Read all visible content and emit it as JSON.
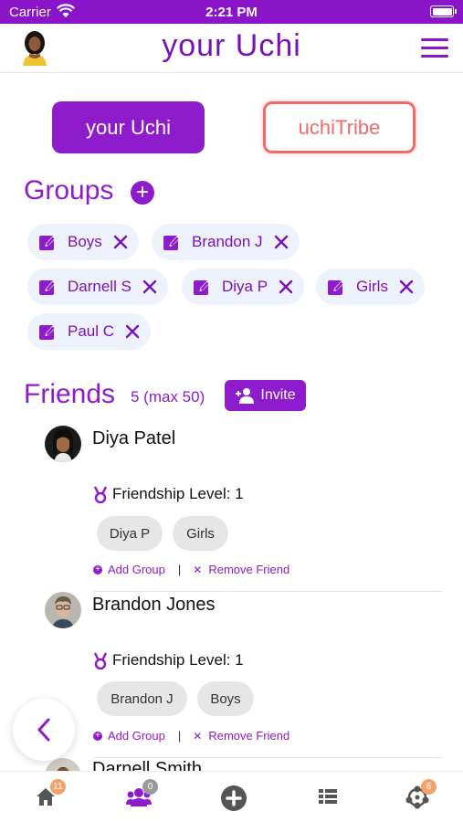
{
  "status_bar": {
    "carrier": "Carrier",
    "time": "2:21 PM"
  },
  "header": {
    "title": "your Uchi"
  },
  "segments": {
    "uchi": "your Uchi",
    "tribe": "uchiTribe"
  },
  "groups": {
    "title": "Groups",
    "chips": [
      "Boys",
      "Brandon J",
      "Darnell S",
      "Diya P",
      "Girls",
      "Paul C"
    ]
  },
  "friends": {
    "title": "Friends",
    "count": "5 (max 50)",
    "invite_label": "Invite",
    "items": [
      {
        "name": "Diya Patel",
        "level": "Friendship Level: 1",
        "groups": [
          "Diya P",
          "Girls"
        ]
      },
      {
        "name": "Brandon Jones",
        "level": "Friendship Level: 1",
        "groups": [
          "Brandon J",
          "Boys"
        ]
      },
      {
        "name": "Darnell Smith"
      }
    ],
    "add_group_label": "Add Group",
    "separator": "|",
    "remove_friend_label": "Remove Friend"
  },
  "tab_bar": {
    "home_badge": "11",
    "friends_badge": "0",
    "tribe_badge": "6"
  },
  "colors": {
    "brand": "#8f1ccc",
    "tribe_accent": "#f06a6a",
    "chip_bg": "#eef2fc",
    "badge_orange": "#f2a36b"
  },
  "icons": [
    "wifi-icon",
    "battery-icon",
    "menu-icon",
    "plus-circle-icon",
    "edit-icon",
    "close-icon",
    "add-user-icon",
    "medal-icon",
    "chevron-left-icon",
    "home-icon",
    "people-icon",
    "add-circle-icon",
    "list-icon",
    "network-icon"
  ]
}
